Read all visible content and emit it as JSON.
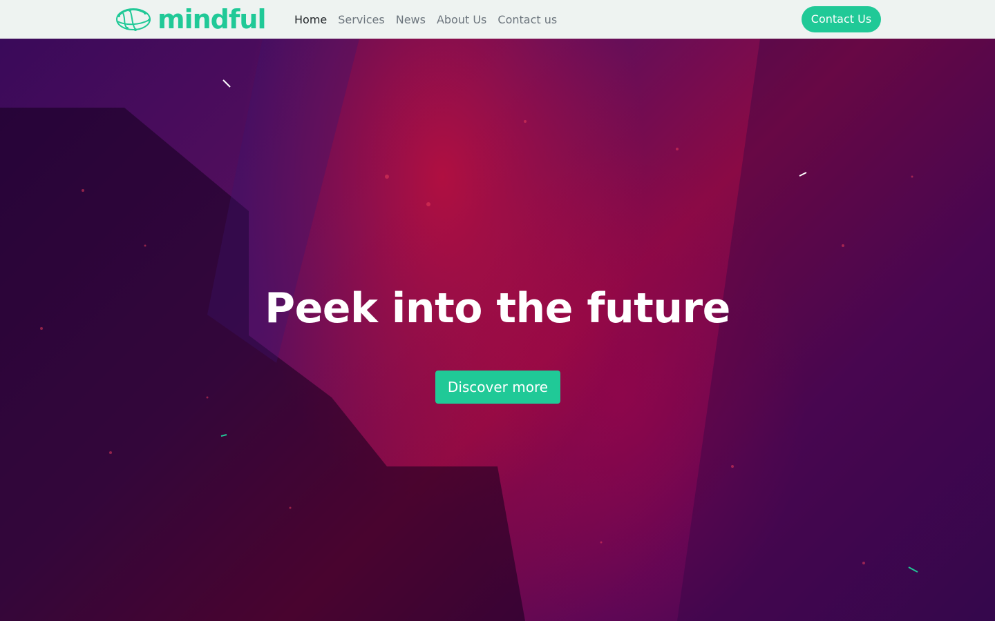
{
  "brand": {
    "name": "mindful",
    "logo_icon": "brain-icon",
    "accent_color": "#20c997"
  },
  "nav": {
    "items": [
      {
        "label": "Home",
        "active": true
      },
      {
        "label": "Services",
        "active": false
      },
      {
        "label": "News",
        "active": false
      },
      {
        "label": "About Us",
        "active": false
      },
      {
        "label": "Contact us",
        "active": false
      }
    ],
    "cta_label": "Contact Us"
  },
  "hero": {
    "title": "Peek into the future",
    "button_label": "Discover more"
  }
}
